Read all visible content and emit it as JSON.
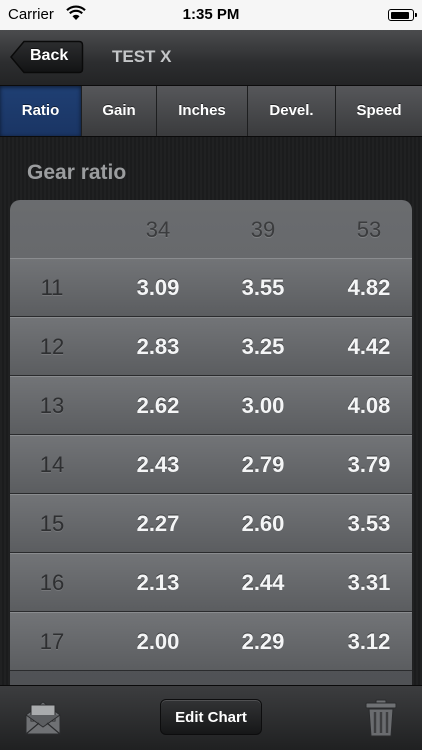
{
  "status_bar": {
    "carrier": "Carrier",
    "time": "1:35 PM"
  },
  "nav": {
    "back_label": "Back",
    "title": "TEST X"
  },
  "tabs": [
    {
      "label": "Ratio",
      "active": true
    },
    {
      "label": "Gain",
      "active": false
    },
    {
      "label": "Inches",
      "active": false
    },
    {
      "label": "Devel.",
      "active": false
    },
    {
      "label": "Speed",
      "active": false
    }
  ],
  "section_title": "Gear ratio",
  "table": {
    "chainrings": [
      "34",
      "39",
      "53"
    ],
    "rows": [
      {
        "cog": "11",
        "values": [
          "3.09",
          "3.55",
          "4.82"
        ]
      },
      {
        "cog": "12",
        "values": [
          "2.83",
          "3.25",
          "4.42"
        ]
      },
      {
        "cog": "13",
        "values": [
          "2.62",
          "3.00",
          "4.08"
        ]
      },
      {
        "cog": "14",
        "values": [
          "2.43",
          "2.79",
          "3.79"
        ]
      },
      {
        "cog": "15",
        "values": [
          "2.27",
          "2.60",
          "3.53"
        ]
      },
      {
        "cog": "16",
        "values": [
          "2.13",
          "2.44",
          "3.31"
        ]
      },
      {
        "cog": "17",
        "values": [
          "2.00",
          "2.29",
          "3.12"
        ]
      }
    ]
  },
  "toolbar": {
    "edit_label": "Edit Chart",
    "mail_icon": "mail-icon",
    "trash_icon": "trash-icon"
  },
  "colors": {
    "active_tab": "#1f3f73",
    "text_value": "#f4f5f6"
  }
}
